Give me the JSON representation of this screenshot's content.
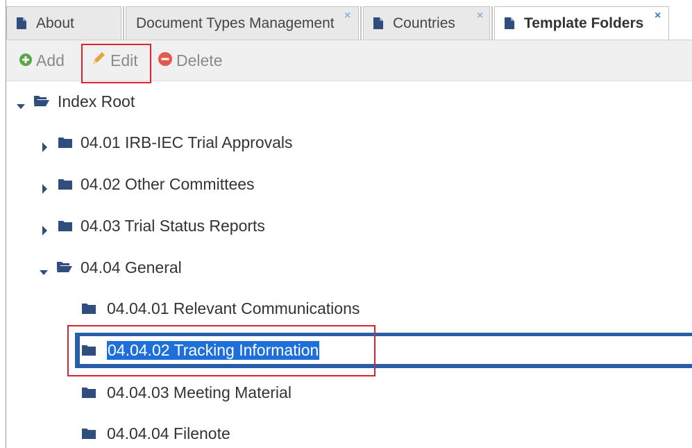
{
  "tabs": [
    {
      "label": "About",
      "closable": false,
      "active": false
    },
    {
      "label": "Document Types Management",
      "closable": true,
      "active": false
    },
    {
      "label": "Countries",
      "closable": true,
      "active": false
    },
    {
      "label": "Template Folders",
      "closable": true,
      "active": true
    }
  ],
  "close_glyph": "×",
  "toolbar": {
    "add_label": "Add",
    "edit_label": "Edit",
    "delete_label": "Delete"
  },
  "tree": {
    "root": {
      "label": "Index Root",
      "expanded": true
    },
    "items": [
      {
        "label": "04.01 IRB-IEC Trial Approvals",
        "expanded": false
      },
      {
        "label": "04.02 Other Committees",
        "expanded": false
      },
      {
        "label": "04.03 Trial Status Reports",
        "expanded": false
      },
      {
        "label": "04.04 General",
        "expanded": true
      },
      {
        "label": "04.04.01 Relevant Communications",
        "leaf": true
      },
      {
        "label": "04.04.02 Tracking Information",
        "leaf": true,
        "selected": true
      },
      {
        "label": "04.04.03 Meeting Material",
        "leaf": true
      },
      {
        "label": "04.04.04 Filenote",
        "leaf": true
      }
    ]
  },
  "colors": {
    "folder": "#2f4d7d",
    "selection": "#2a5da8",
    "highlight_box": "#d9232e",
    "add_icon": "#5aa64a",
    "edit_icon": "#e6a23c",
    "delete_icon": "#e05a4f"
  }
}
